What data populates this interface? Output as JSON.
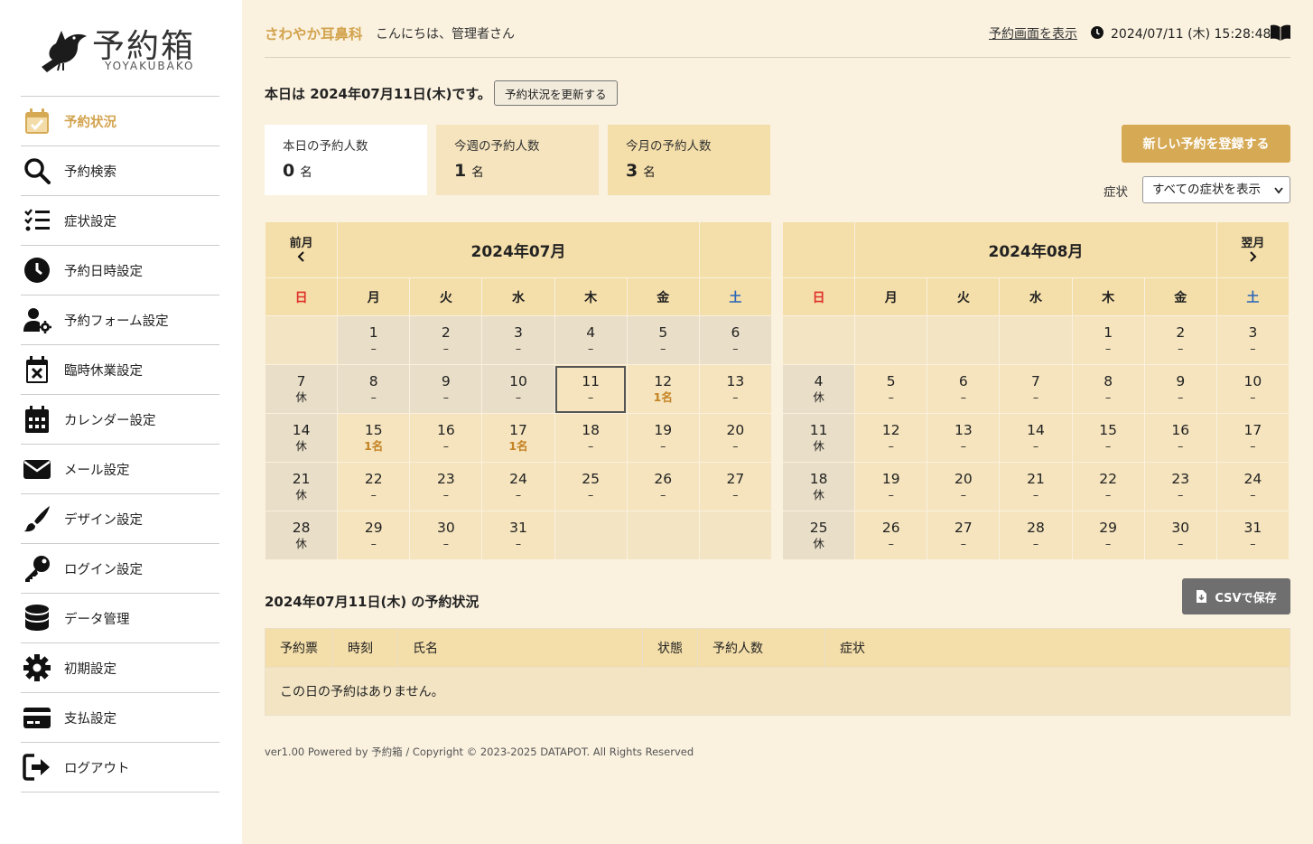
{
  "sidebar": {
    "logo": {
      "name": "予約箱",
      "sub": "YOYAKUBAKO"
    },
    "items": [
      {
        "label": "予約状況",
        "icon": "calendar-check-icon",
        "active": true
      },
      {
        "label": "予約検索",
        "icon": "search-icon"
      },
      {
        "label": "症状設定",
        "icon": "list-check-icon"
      },
      {
        "label": "予約日時設定",
        "icon": "clock-icon"
      },
      {
        "label": "予約フォーム設定",
        "icon": "user-gear-icon"
      },
      {
        "label": "臨時休業設定",
        "icon": "calendar-x-icon"
      },
      {
        "label": "カレンダー設定",
        "icon": "calendar-days-icon"
      },
      {
        "label": "メール設定",
        "icon": "envelope-icon"
      },
      {
        "label": "デザイン設定",
        "icon": "paintbrush-icon"
      },
      {
        "label": "ログイン設定",
        "icon": "key-icon"
      },
      {
        "label": "データ管理",
        "icon": "database-icon"
      },
      {
        "label": "初期設定",
        "icon": "gear-icon"
      },
      {
        "label": "支払設定",
        "icon": "credit-card-icon"
      },
      {
        "label": "ログアウト",
        "icon": "logout-icon"
      }
    ]
  },
  "header": {
    "clinic": "さわやか耳鼻科",
    "greeting": "こんにちは、管理者さん",
    "view_link": "予約画面を表示",
    "datetime": "2024/07/11 (木) 15:28:48"
  },
  "today": {
    "text": "本日は 2024年07月11日(木)です。",
    "refresh": "予約状況を更新する"
  },
  "stats": [
    {
      "title": "本日の予約人数",
      "value": "0",
      "unit": "名"
    },
    {
      "title": "今週の予約人数",
      "value": "1",
      "unit": "名"
    },
    {
      "title": "今月の予約人数",
      "value": "3",
      "unit": "名"
    }
  ],
  "new_button": "新しい予約を登録する",
  "symptom": {
    "label": "症状",
    "selected": "すべての症状を表示"
  },
  "weekdays": [
    "日",
    "月",
    "火",
    "水",
    "木",
    "金",
    "土"
  ],
  "calendars": [
    {
      "title": "2024年07月",
      "prev": "前月",
      "next": "",
      "weeks": [
        [
          {
            "d": "",
            "t": "empty"
          },
          {
            "d": "1",
            "s": "–",
            "t": "past"
          },
          {
            "d": "2",
            "s": "–",
            "t": "past"
          },
          {
            "d": "3",
            "s": "–",
            "t": "past"
          },
          {
            "d": "4",
            "s": "–",
            "t": "past"
          },
          {
            "d": "5",
            "s": "–",
            "t": "past"
          },
          {
            "d": "6",
            "s": "–",
            "t": "past"
          }
        ],
        [
          {
            "d": "7",
            "s": "休",
            "t": "holiday"
          },
          {
            "d": "8",
            "s": "–",
            "t": "past"
          },
          {
            "d": "9",
            "s": "–",
            "t": "past"
          },
          {
            "d": "10",
            "s": "–",
            "t": "past"
          },
          {
            "d": "11",
            "s": "–",
            "t": "today"
          },
          {
            "d": "12",
            "s": "1名",
            "t": "cnt"
          },
          {
            "d": "13",
            "s": "–"
          }
        ],
        [
          {
            "d": "14",
            "s": "休",
            "t": "holiday"
          },
          {
            "d": "15",
            "s": "1名",
            "t": "cnt"
          },
          {
            "d": "16",
            "s": "–"
          },
          {
            "d": "17",
            "s": "1名",
            "t": "cnt"
          },
          {
            "d": "18",
            "s": "–"
          },
          {
            "d": "19",
            "s": "–"
          },
          {
            "d": "20",
            "s": "–"
          }
        ],
        [
          {
            "d": "21",
            "s": "休",
            "t": "holiday"
          },
          {
            "d": "22",
            "s": "–"
          },
          {
            "d": "23",
            "s": "–"
          },
          {
            "d": "24",
            "s": "–"
          },
          {
            "d": "25",
            "s": "–"
          },
          {
            "d": "26",
            "s": "–"
          },
          {
            "d": "27",
            "s": "–"
          }
        ],
        [
          {
            "d": "28",
            "s": "休",
            "t": "holiday"
          },
          {
            "d": "29",
            "s": "–"
          },
          {
            "d": "30",
            "s": "–"
          },
          {
            "d": "31",
            "s": "–"
          },
          {
            "d": "",
            "t": "empty"
          },
          {
            "d": "",
            "t": "empty"
          },
          {
            "d": "",
            "t": "empty"
          }
        ]
      ]
    },
    {
      "title": "2024年08月",
      "prev": "",
      "next": "翌月",
      "weeks": [
        [
          {
            "d": "",
            "t": "empty"
          },
          {
            "d": "",
            "t": "empty"
          },
          {
            "d": "",
            "t": "empty"
          },
          {
            "d": "",
            "t": "empty"
          },
          {
            "d": "1",
            "s": "–"
          },
          {
            "d": "2",
            "s": "–"
          },
          {
            "d": "3",
            "s": "–"
          }
        ],
        [
          {
            "d": "4",
            "s": "休",
            "t": "holiday"
          },
          {
            "d": "5",
            "s": "–"
          },
          {
            "d": "6",
            "s": "–"
          },
          {
            "d": "7",
            "s": "–"
          },
          {
            "d": "8",
            "s": "–"
          },
          {
            "d": "9",
            "s": "–"
          },
          {
            "d": "10",
            "s": "–"
          }
        ],
        [
          {
            "d": "11",
            "s": "休",
            "t": "holiday"
          },
          {
            "d": "12",
            "s": "–"
          },
          {
            "d": "13",
            "s": "–"
          },
          {
            "d": "14",
            "s": "–"
          },
          {
            "d": "15",
            "s": "–"
          },
          {
            "d": "16",
            "s": "–"
          },
          {
            "d": "17",
            "s": "–"
          }
        ],
        [
          {
            "d": "18",
            "s": "休",
            "t": "holiday"
          },
          {
            "d": "19",
            "s": "–"
          },
          {
            "d": "20",
            "s": "–"
          },
          {
            "d": "21",
            "s": "–"
          },
          {
            "d": "22",
            "s": "–"
          },
          {
            "d": "23",
            "s": "–"
          },
          {
            "d": "24",
            "s": "–"
          }
        ],
        [
          {
            "d": "25",
            "s": "休",
            "t": "holiday"
          },
          {
            "d": "26",
            "s": "–"
          },
          {
            "d": "27",
            "s": "–"
          },
          {
            "d": "28",
            "s": "–"
          },
          {
            "d": "29",
            "s": "–"
          },
          {
            "d": "30",
            "s": "–"
          },
          {
            "d": "31",
            "s": "–"
          }
        ]
      ]
    }
  ],
  "day_section": {
    "title": "2024年07月11日(木) の予約状況",
    "csv": "CSVで保存",
    "columns": [
      "予約票",
      "時刻",
      "氏名",
      "状態",
      "予約人数",
      "症状"
    ],
    "empty": "この日の予約はありません。"
  },
  "footer": "ver1.00 Powered by 予約箱 / Copyright © 2023-2025 DATAPOT. All Rights Reserved",
  "colors": {
    "accent": "#d6a954",
    "background": "#faf1df",
    "cell": "#f5e4bd",
    "header_cell": "#f4dea9"
  }
}
